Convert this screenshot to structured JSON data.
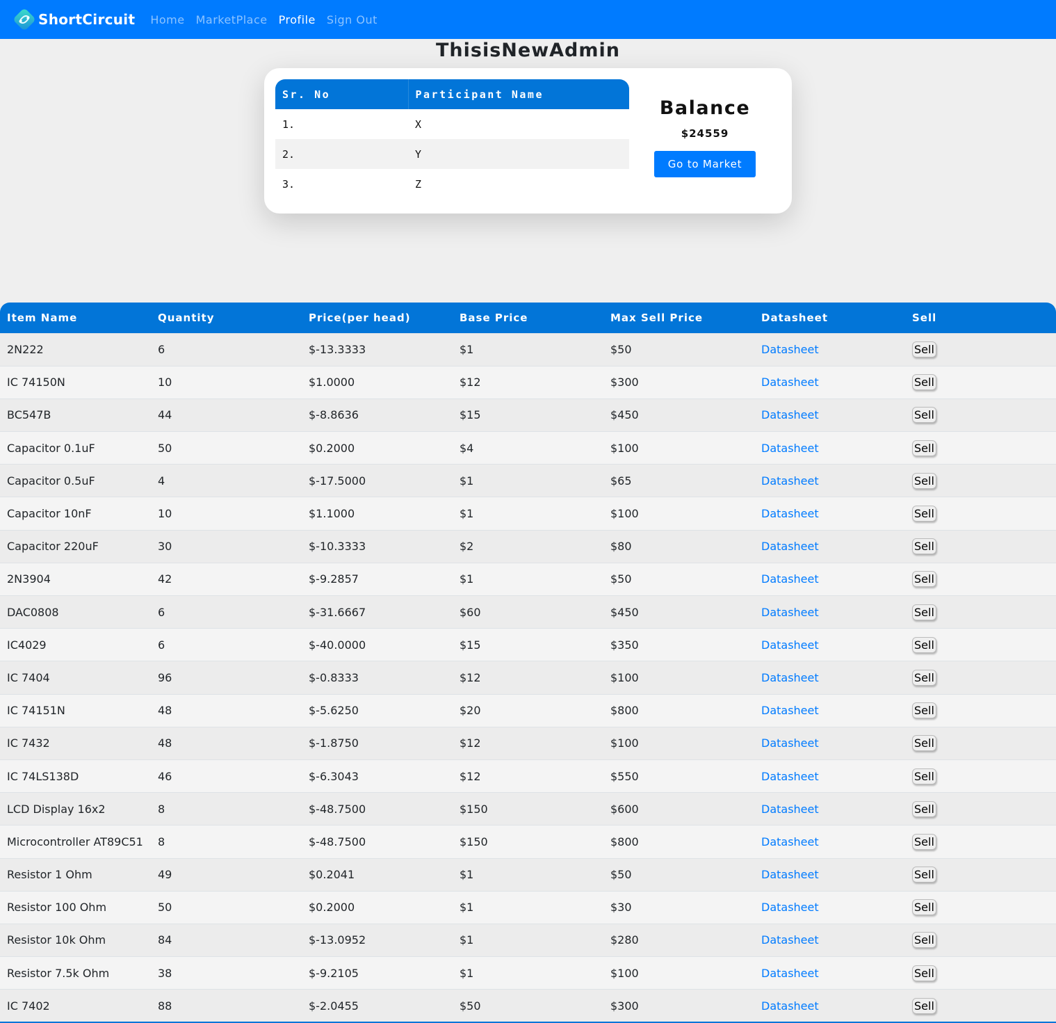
{
  "nav": {
    "brand": "ShortCircuit",
    "links": [
      {
        "label": "Home"
      },
      {
        "label": "MarketPlace"
      },
      {
        "label": "Profile"
      },
      {
        "label": "Sign Out"
      }
    ]
  },
  "page_title": "ThisisNewAdmin",
  "participants": {
    "headers": [
      "Sr. No",
      "Participant Name"
    ],
    "rows": [
      {
        "sr": "1.",
        "name": "X"
      },
      {
        "sr": "2.",
        "name": "Y"
      },
      {
        "sr": "3.",
        "name": "Z"
      }
    ]
  },
  "balance": {
    "title": "Balance",
    "value": "$24559",
    "button_label": "Go to Market"
  },
  "items": {
    "headers": [
      "Item Name",
      "Quantity",
      "Price(per head)",
      "Base Price",
      "Max Sell Price",
      "Datasheet",
      "Sell"
    ],
    "link_label": "Datasheet",
    "sell_label": "Sell",
    "rows": [
      {
        "name": "2N222",
        "qty": "6",
        "price": "$-13.3333",
        "base": "$1",
        "max": "$50"
      },
      {
        "name": "IC 74150N",
        "qty": "10",
        "price": "$1.0000",
        "base": "$12",
        "max": "$300"
      },
      {
        "name": "BC547B",
        "qty": "44",
        "price": "$-8.8636",
        "base": "$15",
        "max": "$450"
      },
      {
        "name": "Capacitor 0.1uF",
        "qty": "50",
        "price": "$0.2000",
        "base": "$4",
        "max": "$100"
      },
      {
        "name": "Capacitor 0.5uF",
        "qty": "4",
        "price": "$-17.5000",
        "base": "$1",
        "max": "$65"
      },
      {
        "name": "Capacitor 10nF",
        "qty": "10",
        "price": "$1.1000",
        "base": "$1",
        "max": "$100"
      },
      {
        "name": "Capacitor 220uF",
        "qty": "30",
        "price": "$-10.3333",
        "base": "$2",
        "max": "$80"
      },
      {
        "name": "2N3904",
        "qty": "42",
        "price": "$-9.2857",
        "base": "$1",
        "max": "$50"
      },
      {
        "name": "DAC0808",
        "qty": "6",
        "price": "$-31.6667",
        "base": "$60",
        "max": "$450"
      },
      {
        "name": "IC4029",
        "qty": "6",
        "price": "$-40.0000",
        "base": "$15",
        "max": "$350"
      },
      {
        "name": "IC 7404",
        "qty": "96",
        "price": "$-0.8333",
        "base": "$12",
        "max": "$100"
      },
      {
        "name": "IC 74151N",
        "qty": "48",
        "price": "$-5.6250",
        "base": "$20",
        "max": "$800"
      },
      {
        "name": "IC 7432",
        "qty": "48",
        "price": "$-1.8750",
        "base": "$12",
        "max": "$100"
      },
      {
        "name": "IC 74LS138D",
        "qty": "46",
        "price": "$-6.3043",
        "base": "$12",
        "max": "$550"
      },
      {
        "name": "LCD Display 16x2",
        "qty": "8",
        "price": "$-48.7500",
        "base": "$150",
        "max": "$600"
      },
      {
        "name": "Microcontroller AT89C51",
        "qty": "8",
        "price": "$-48.7500",
        "base": "$150",
        "max": "$800"
      },
      {
        "name": "Resistor 1 Ohm",
        "qty": "49",
        "price": "$0.2041",
        "base": "$1",
        "max": "$50"
      },
      {
        "name": "Resistor 100 Ohm",
        "qty": "50",
        "price": "$0.2000",
        "base": "$1",
        "max": "$30"
      },
      {
        "name": "Resistor 10k Ohm",
        "qty": "84",
        "price": "$-13.0952",
        "base": "$1",
        "max": "$280"
      },
      {
        "name": "Resistor 7.5k Ohm",
        "qty": "38",
        "price": "$-9.2105",
        "base": "$1",
        "max": "$100"
      },
      {
        "name": "IC 7402",
        "qty": "88",
        "price": "$-2.0455",
        "base": "$50",
        "max": "$300"
      }
    ]
  },
  "colors": {
    "primary": "#007bff",
    "table_header": "#0275d8",
    "background": "#efefef"
  }
}
